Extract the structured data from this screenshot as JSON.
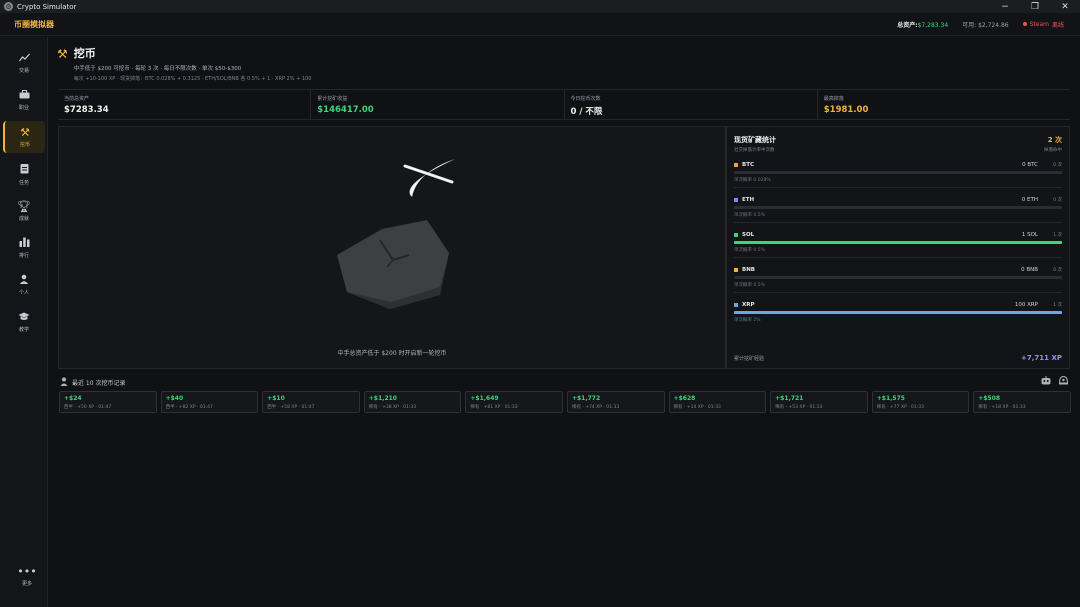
{
  "window": {
    "title": "Crypto Simulator"
  },
  "header": {
    "brand": "币圈模拟器",
    "total_label": "总资产:",
    "total_value": "$7,283.34",
    "available": "可用: $2,724.86",
    "steam_label": "Steam",
    "steam_status": "离线"
  },
  "sidebar": {
    "items": [
      {
        "label": "交易",
        "icon": "chart-line-icon"
      },
      {
        "label": "职业",
        "icon": "briefcase-icon"
      },
      {
        "label": "挖币",
        "icon": "pickaxe-icon",
        "active": true
      },
      {
        "label": "任务",
        "icon": "clipboard-icon"
      },
      {
        "label": "成就",
        "icon": "trophy-icon"
      },
      {
        "label": "排行",
        "icon": "bar-chart-icon"
      },
      {
        "label": "个人",
        "icon": "person-icon"
      },
      {
        "label": "教学",
        "icon": "graduation-cap-icon"
      }
    ],
    "more_label": "更多"
  },
  "page": {
    "title": "挖币",
    "subtitle": "中手低于 $200 可挖币 · 每轮 3 次 · 每日不限次数 · 单次 $50-$300",
    "subtitle2": "每次 +10-100 XP · 现货掉落：BTC 0.028% + 0.3125 · ETH/SOL/BNB 各 0.5% + 1 · XRP 2% + 100"
  },
  "stats": [
    {
      "label": "当前总资产",
      "value": "$7283.34",
      "color": "#f0f0f0"
    },
    {
      "label": "累计挖矿收益",
      "value": "$146417.00",
      "color": "#3ed47a"
    },
    {
      "label": "今日挖币次数",
      "value": "0 / 不限",
      "color": "#f0f0f0"
    },
    {
      "label": "最高掉落",
      "value": "$1981.00",
      "color": "#f2b33c"
    }
  ],
  "mine": {
    "hint": "中手总资产低于 $200 时开启新一轮挖币"
  },
  "spot": {
    "title": "现货矿藏统计",
    "subtitle": "社交掉落计率中次数",
    "count": "2 次",
    "count_sub": "掉落命中",
    "coins": [
      {
        "name": "BTC",
        "amount": "0 BTC",
        "times": "0 次",
        "rate": "单次概率 0.028%",
        "color": "#f2a23c",
        "fill": 0
      },
      {
        "name": "ETH",
        "amount": "0 ETH",
        "times": "0 次",
        "rate": "单次概率 0.5%",
        "color": "#8f84f5",
        "fill": 0
      },
      {
        "name": "SOL",
        "amount": "1 SOL",
        "times": "1 次",
        "rate": "单次概率 0.5%",
        "color": "#3ed47a",
        "fill": 1
      },
      {
        "name": "BNB",
        "amount": "0 BNB",
        "times": "0 次",
        "rate": "单次概率 0.5%",
        "color": "#f2b33c",
        "fill": 0
      },
      {
        "name": "XRP",
        "amount": "100 XRP",
        "times": "1 次",
        "rate": "单次概率 2%",
        "color": "#6aa6e8",
        "fill": 1
      }
    ],
    "xp_label": "累计挖矿经验",
    "xp_value": "+7,711 XP"
  },
  "recent": {
    "title": "最近 10 次挖币记录",
    "records": [
      {
        "amount": "+$24",
        "meta": "西半 · +50 XP · 01:47"
      },
      {
        "amount": "+$40",
        "meta": "西半 · +82 XP · 01:47"
      },
      {
        "amount": "+$10",
        "meta": "西半 · +58 XP · 01:47"
      },
      {
        "amount": "+$1,210",
        "meta": "稀有 · +38 XP · 01:33"
      },
      {
        "amount": "+$1,649",
        "meta": "稀有 · +81 XP · 01:33"
      },
      {
        "amount": "+$1,772",
        "meta": "稀有 · +74 XP · 01:33"
      },
      {
        "amount": "+$628",
        "meta": "稀有 · +14 XP · 01:33"
      },
      {
        "amount": "+$1,721",
        "meta": "稀有 · +53 XP · 01:33"
      },
      {
        "amount": "+$1,575",
        "meta": "稀有 · +77 XP · 01:33"
      },
      {
        "amount": "+$508",
        "meta": "稀有 · +18 XP · 01:33"
      }
    ]
  }
}
